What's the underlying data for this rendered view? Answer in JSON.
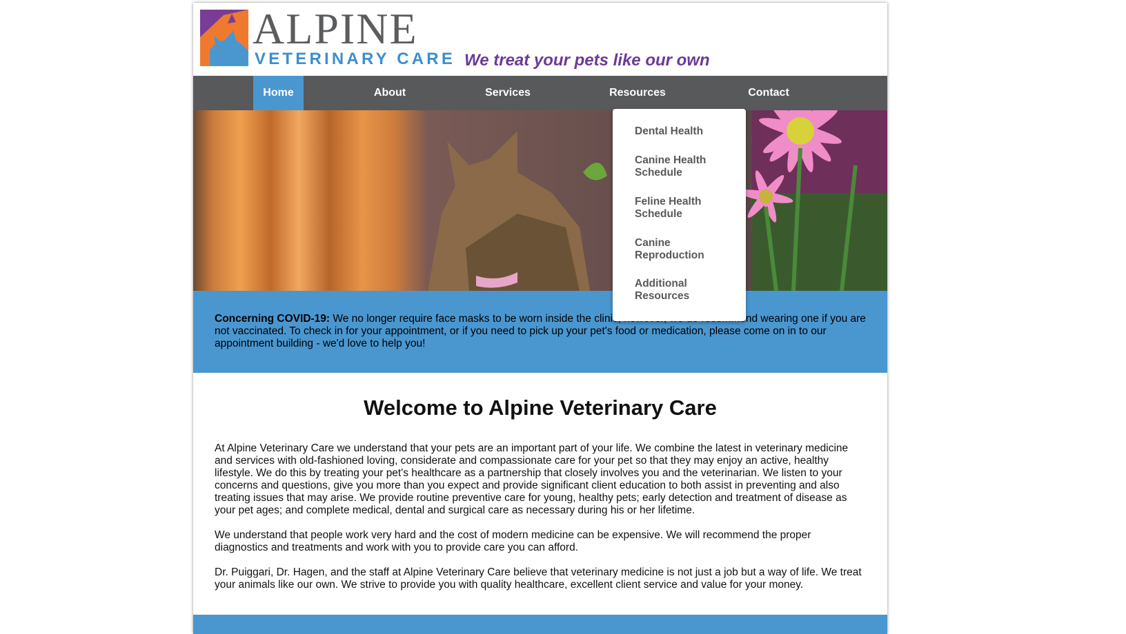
{
  "header": {
    "logo_word1": "ALPINE",
    "logo_word2": "VETERINARY CARE",
    "tagline": "We treat your pets like our own"
  },
  "nav": {
    "items": [
      {
        "label": "Home",
        "active": true
      },
      {
        "label": "About"
      },
      {
        "label": "Services"
      },
      {
        "label": "Resources"
      },
      {
        "label": "Contact"
      }
    ]
  },
  "resources_menu": {
    "items": [
      {
        "label": "Dental Health"
      },
      {
        "label": "Canine Health Schedule"
      },
      {
        "label": "Feline Health Schedule"
      },
      {
        "label": "Canine Reproduction"
      },
      {
        "label": "Additional Resources"
      }
    ]
  },
  "notice": {
    "heading": "Concerning COVID-19:",
    "text": " We no longer require face masks to be worn inside the clinic, however, we do recommend wearing one if you are not vaccinated. To check in for your appointment, or if you need to pick up your pet's food or medication, please come on in to our appointment building - we'd love to help you!"
  },
  "main": {
    "title": "Welcome to Alpine Veterinary Care",
    "paragraphs": [
      "At Alpine Veterinary Care we understand that your pets are an important part of your life. We combine the latest in veterinary medicine and services with old-fashioned loving, considerate and compassionate care for your pet so that they may enjoy an active, healthy lifestyle. We do this by treating your pet's healthcare as a partnership that closely involves you and the veterinarian. We listen to your concerns and questions, give you more than you expect and provide significant client education to both assist in preventing and also treating issues that may arise. We provide routine preventive care for young, healthy pets; early detection and treatment of disease as your pet ages; and complete medical, dental and surgical care as necessary during his or her lifetime.",
      "We understand that people work very hard and the cost of modern medicine can be expensive. We will recommend the proper diagnostics and treatments and work with you to provide care you can afford.",
      "Dr. Puiggari, Dr. Hagen, and the staff at Alpine Veterinary Care believe that veterinary medicine is not just a job but a way of life. We treat your animals like our own. We strive to provide you with quality healthcare, excellent client service and value for your money."
    ]
  },
  "colors": {
    "nav_bg": "#58595b",
    "accent_blue": "#4a97d0",
    "tagline_purple": "#6b3a96",
    "logo_orange": "#ef7a2f",
    "logo_purple": "#7a3d96"
  },
  "icons": {
    "logo": "cat-and-dog-logo-icon"
  }
}
